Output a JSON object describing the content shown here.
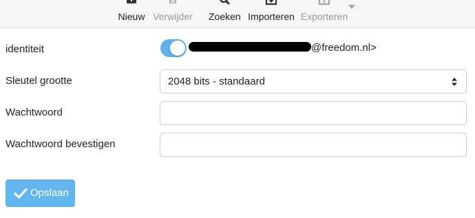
{
  "toolbar": {
    "new_label": "Nieuw",
    "delete_label": "Verwijder",
    "search_label": "Zoeken",
    "import_label": "Importeren",
    "export_label": "Exporteren"
  },
  "form": {
    "identity_label": "identiteit",
    "identity_toggle_on": true,
    "identity_value_suffix": "@freedom.nl>",
    "key_size_label": "Sleutel grootte",
    "key_size_value": "2048 bits - standaard",
    "password_label": "Wachtwoord",
    "password_value": "",
    "confirm_password_label": "Wachtwoord bevestigen",
    "confirm_password_value": ""
  },
  "save_button": {
    "label": "Opslaan"
  },
  "colors": {
    "accent": "#5fb0ec",
    "save_button": "#63b5ef",
    "disabled_text": "#9a9a9a"
  },
  "icons": [
    "plus-icon",
    "trash-icon",
    "search-icon",
    "import-icon",
    "export-icon",
    "chevron-down-icon",
    "select-arrows-icon",
    "check-icon"
  ]
}
